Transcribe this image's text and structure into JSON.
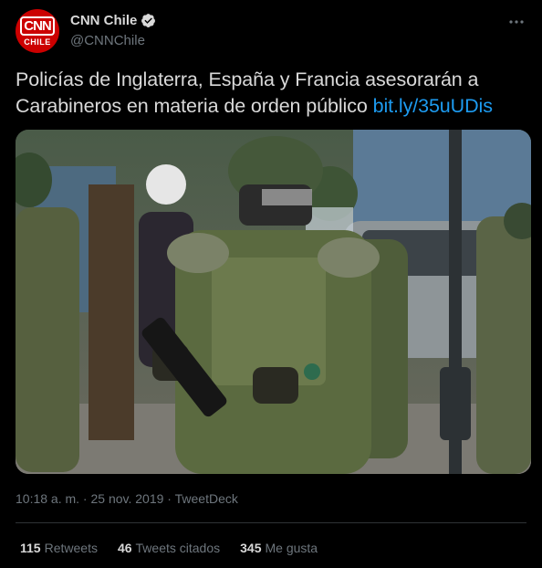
{
  "author": {
    "avatar_line1": "CNN",
    "avatar_line2": "CHILE",
    "name": "CNN Chile",
    "handle": "@CNNChile"
  },
  "tweet": {
    "text": "Policías de Inglaterra, España y Francia asesorarán a Carabineros en materia de orden público",
    "link": "bit.ly/35uUDis"
  },
  "meta": {
    "time": "10:18 a. m.",
    "separator": " · ",
    "date": "25 nov. 2019",
    "source": "TweetDeck"
  },
  "stats": [
    {
      "count": "115",
      "label": "Retweets"
    },
    {
      "count": "46",
      "label": "Tweets citados"
    },
    {
      "count": "345",
      "label": "Me gusta"
    }
  ],
  "colors": {
    "background": "#000000",
    "text": "#d9d9d9",
    "muted": "#6e767d",
    "link": "#1d9bf0",
    "brand_red": "#cc0000"
  },
  "icons": {
    "verified": "verified-badge-icon",
    "more": "more-options-icon"
  }
}
